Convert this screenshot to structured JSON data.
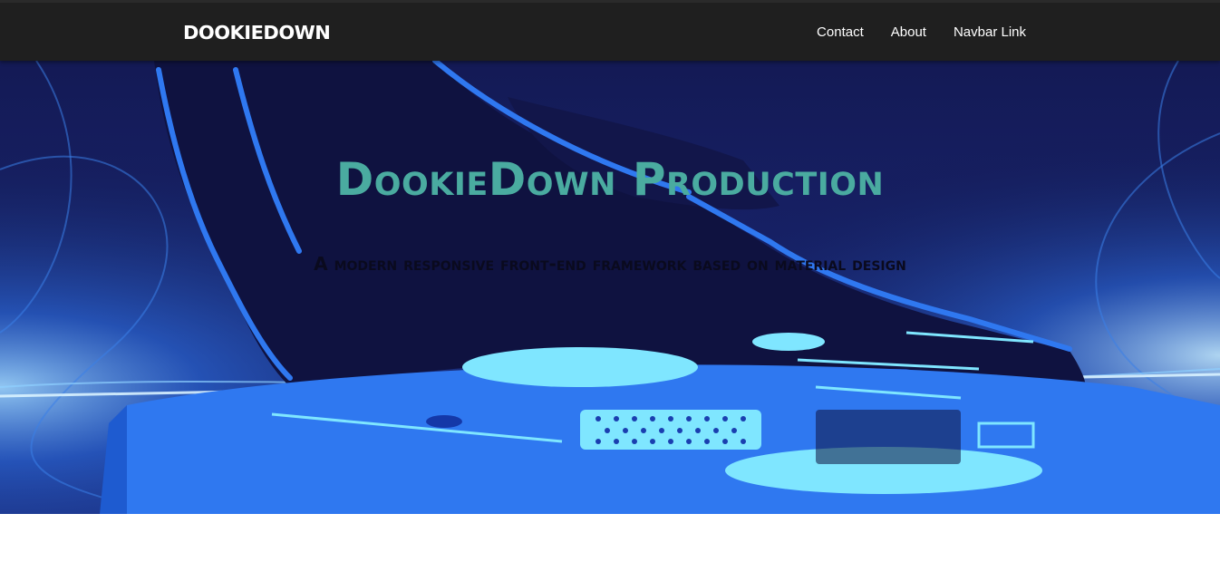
{
  "navbar": {
    "brand": "DookieDown",
    "links": [
      {
        "label": "Contact"
      },
      {
        "label": "About"
      },
      {
        "label": "Navbar Link"
      }
    ]
  },
  "hero": {
    "title": "DookieDown Production",
    "subtitle": "A modern responsive front-end framework based on material design"
  },
  "colors": {
    "navbar_bg": "#1f1f1f",
    "hero_title": "#4aaba0",
    "hero_bg": "#101540",
    "turntable_blue": "#2f78f0",
    "light_cyan": "#7fe6ff"
  }
}
